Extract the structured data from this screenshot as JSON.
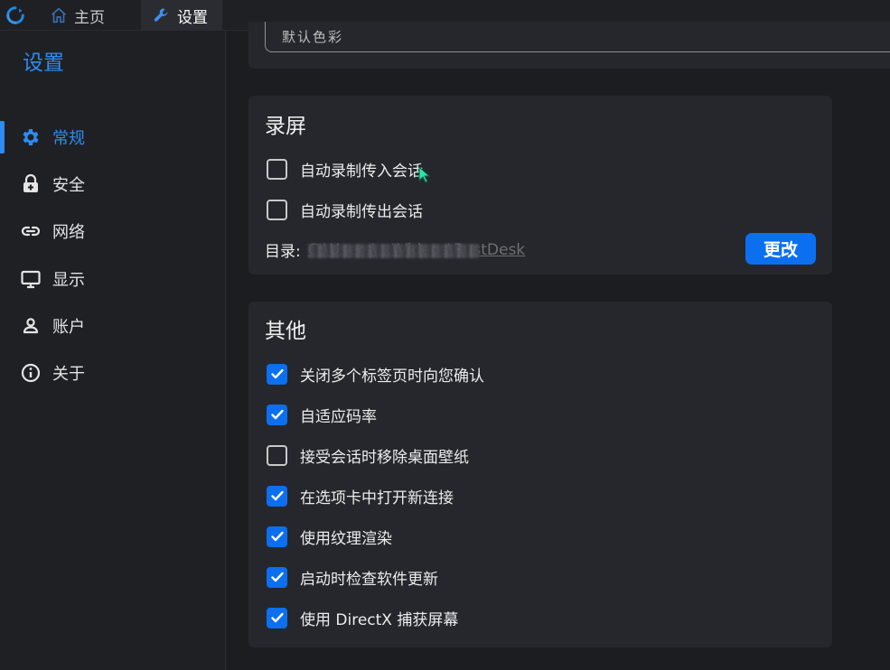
{
  "tabs": {
    "home_label": "主页",
    "settings_label": "设置"
  },
  "sidebar": {
    "title": "设置",
    "items": [
      {
        "label": "常规",
        "icon": "gear-icon",
        "active": true
      },
      {
        "label": "安全",
        "icon": "lock-icon"
      },
      {
        "label": "网络",
        "icon": "link-icon"
      },
      {
        "label": "显示",
        "icon": "monitor-icon"
      },
      {
        "label": "账户",
        "icon": "user-icon"
      },
      {
        "label": "关于",
        "icon": "info-icon"
      }
    ]
  },
  "top_field": {
    "value": "默认色彩"
  },
  "record": {
    "title": "录屏",
    "options": [
      {
        "label": "自动录制传入会话",
        "checked": false
      },
      {
        "label": "自动录制传出会话",
        "checked": false
      }
    ],
    "dir_label": "目录:",
    "dir_path": "C:\\Users\\...\\Videos\\RustDesk",
    "change_label": "更改"
  },
  "other": {
    "title": "其他",
    "options": [
      {
        "label": "关闭多个标签页时向您确认",
        "checked": true
      },
      {
        "label": "自适应码率",
        "checked": true
      },
      {
        "label": "接受会话时移除桌面壁纸",
        "checked": false
      },
      {
        "label": "在选项卡中打开新连接",
        "checked": true
      },
      {
        "label": "使用纹理渲染",
        "checked": true
      },
      {
        "label": "启动时检查软件更新",
        "checked": true
      },
      {
        "label": "使用 DirectX 捕获屏幕",
        "checked": true
      }
    ]
  },
  "colors": {
    "accent": "#2d8cf0",
    "checkbox": "#0b6ff0",
    "card": "#26272c",
    "background": "#1c1d21"
  }
}
